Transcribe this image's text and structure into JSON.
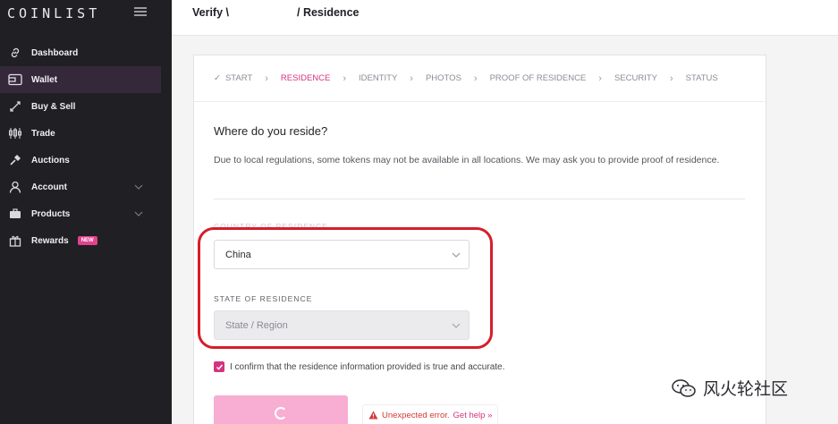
{
  "sidebar": {
    "logo": "COINLIST",
    "items": [
      {
        "label": "Dashboard",
        "icon": "link-icon"
      },
      {
        "label": "Wallet",
        "icon": "wallet-icon",
        "active": true
      },
      {
        "label": "Buy & Sell",
        "icon": "swap-arrows-icon"
      },
      {
        "label": "Trade",
        "icon": "candlestick-icon"
      },
      {
        "label": "Auctions",
        "icon": "gavel-icon"
      },
      {
        "label": "Account",
        "icon": "user-icon",
        "expandable": true
      },
      {
        "label": "Products",
        "icon": "briefcase-icon",
        "expandable": true
      },
      {
        "label": "Rewards",
        "icon": "gift-icon",
        "badge": "NEW"
      }
    ]
  },
  "header": {
    "title_start": "Verify \\",
    "title_end": "/ Residence"
  },
  "steps": [
    {
      "label": "START",
      "state": "done"
    },
    {
      "label": "RESIDENCE",
      "state": "active"
    },
    {
      "label": "IDENTITY",
      "state": "pending"
    },
    {
      "label": "PHOTOS",
      "state": "pending"
    },
    {
      "label": "PROOF OF RESIDENCE",
      "state": "pending"
    },
    {
      "label": "SECURITY",
      "state": "pending"
    },
    {
      "label": "STATUS",
      "state": "pending"
    }
  ],
  "form": {
    "question": "Where do you reside?",
    "description": "Due to local regulations, some tokens may not be available in all locations. We may ask you to provide proof of residence.",
    "country_label": "COUNTRY OF RESIDENCE",
    "country_value": "China",
    "state_label": "STATE OF RESIDENCE",
    "state_placeholder": "State / Region",
    "confirm_text": "I confirm that the residence information provided is true and accurate.",
    "confirm_checked": true
  },
  "error": {
    "message": "Unexpected error.",
    "link": "Get help »"
  },
  "watermark": "风火轮社区",
  "colors": {
    "accent": "#d5337f",
    "sidebar_bg": "#1f1f24",
    "submit_disabled": "#f7aed2",
    "highlight": "#d41f2a"
  }
}
